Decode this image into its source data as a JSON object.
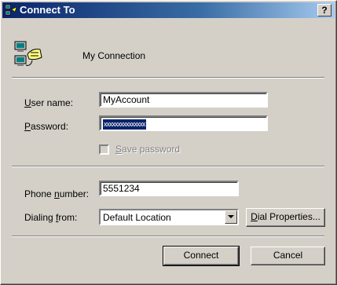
{
  "window": {
    "title": "Connect To",
    "help_glyph": "?"
  },
  "connection": {
    "name": "My Connection",
    "icon": "network-computers-icon"
  },
  "user_name": {
    "label_u": "U",
    "label_rest": "ser name:",
    "value": "MyAccount"
  },
  "password": {
    "label_u": "P",
    "label_rest": "assword:",
    "value": "xxxxxxxxxxxxxxx"
  },
  "save_password": {
    "label_u": "S",
    "label_rest": "ave password",
    "checked": false,
    "enabled": false
  },
  "phone_number": {
    "label_pre": "Phone ",
    "label_u": "n",
    "label_rest": "umber:",
    "value": "5551234"
  },
  "dialing_from": {
    "label_pre": "Dialing ",
    "label_u": "f",
    "label_rest": "rom:",
    "value": "Default Location"
  },
  "buttons": {
    "dial_properties_u": "D",
    "dial_properties_rest": "ial Properties...",
    "connect": "Connect",
    "cancel": "Cancel"
  },
  "colors": {
    "face": "#d4d0c8",
    "titlebar": "#0a246a",
    "selection": "#0a246a"
  }
}
